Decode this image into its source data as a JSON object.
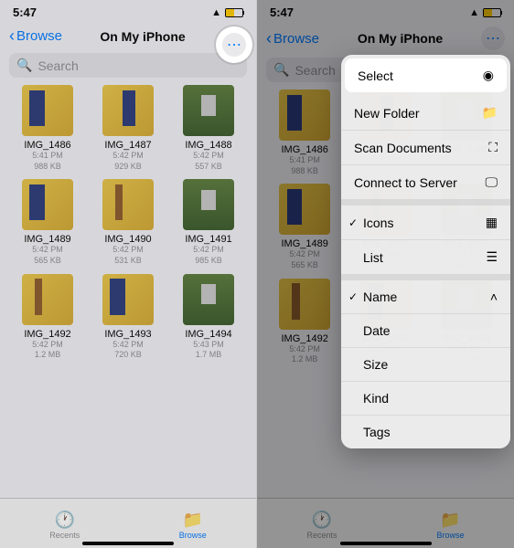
{
  "status": {
    "time": "5:47"
  },
  "nav": {
    "back": "Browse",
    "title": "On My iPhone"
  },
  "search": {
    "placeholder": "Search"
  },
  "files": [
    {
      "name": "IMG_1486",
      "time": "5:41 PM",
      "size": "988 KB",
      "variant": ""
    },
    {
      "name": "IMG_1487",
      "time": "5:42 PM",
      "size": "929 KB",
      "variant": "v2"
    },
    {
      "name": "IMG_1488",
      "time": "5:42 PM",
      "size": "557 KB",
      "variant": "v3"
    },
    {
      "name": "IMG_1489",
      "time": "5:42 PM",
      "size": "565 KB",
      "variant": ""
    },
    {
      "name": "IMG_1490",
      "time": "5:42 PM",
      "size": "531 KB",
      "variant": "v4"
    },
    {
      "name": "IMG_1491",
      "time": "5:42 PM",
      "size": "985 KB",
      "variant": "v3"
    },
    {
      "name": "IMG_1492",
      "time": "5:42 PM",
      "size": "1.2 MB",
      "variant": "v4"
    },
    {
      "name": "IMG_1493",
      "time": "5:42 PM",
      "size": "720 KB",
      "variant": ""
    },
    {
      "name": "IMG_1494",
      "time": "5:43 PM",
      "size": "1.7 MB",
      "variant": "v3"
    }
  ],
  "tabs": {
    "recents": "Recents",
    "browse": "Browse"
  },
  "menu": {
    "select": "Select",
    "newFolder": "New Folder",
    "scan": "Scan Documents",
    "connect": "Connect to Server",
    "icons": "Icons",
    "list": "List",
    "name": "Name",
    "date": "Date",
    "size": "Size",
    "kind": "Kind",
    "tags": "Tags"
  }
}
